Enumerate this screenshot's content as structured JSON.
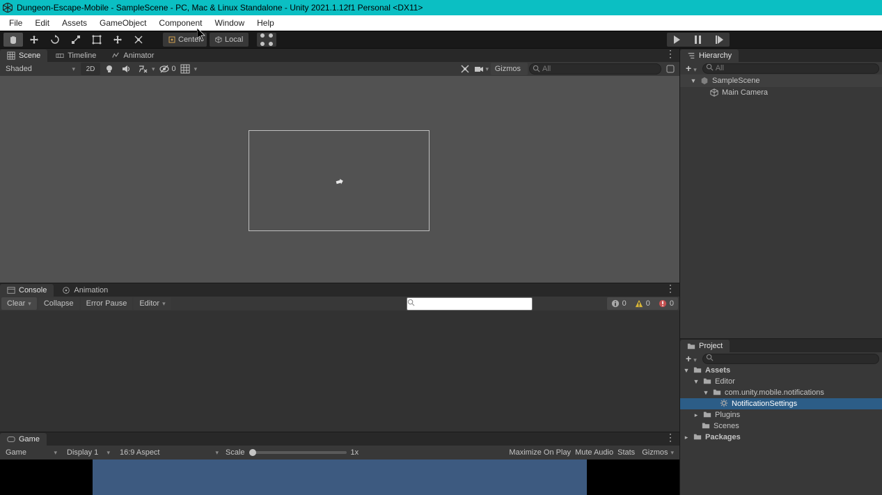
{
  "title": "Dungeon-Escape-Mobile - SampleScene - PC, Mac & Linux Standalone - Unity 2021.1.12f1 Personal <DX11>",
  "menu": [
    "File",
    "Edit",
    "Assets",
    "GameObject",
    "Component",
    "Window",
    "Help"
  ],
  "pivot": {
    "center": "Center",
    "local": "Local"
  },
  "tabs": {
    "scene": "Scene",
    "timeline": "Timeline",
    "animator": "Animator",
    "console": "Console",
    "animation": "Animation",
    "game": "Game",
    "hierarchy": "Hierarchy",
    "project": "Project"
  },
  "scene_toolbar": {
    "draw_mode": "Shaded",
    "mode2d": "2D",
    "zero": "0",
    "gizmos": "Gizmos",
    "search_placeholder": "All"
  },
  "console": {
    "clear": "Clear",
    "collapse": "Collapse",
    "error_pause": "Error Pause",
    "editor": "Editor",
    "counts": {
      "info": "0",
      "warn": "0",
      "error": "0"
    }
  },
  "game_toolbar": {
    "game": "Game",
    "display": "Display 1",
    "aspect": "16:9 Aspect",
    "scale_label": "Scale",
    "scale_value": "1x",
    "maximize": "Maximize On Play",
    "mute": "Mute Audio",
    "stats": "Stats",
    "gizmos": "Gizmos"
  },
  "hierarchy": {
    "search_placeholder": "All",
    "scene": "SampleScene",
    "items": [
      "Main Camera"
    ]
  },
  "project": {
    "tree": {
      "assets": "Assets",
      "editor": "Editor",
      "notif_folder": "com.unity.mobile.notifications",
      "notif_settings": "NotificationSettings",
      "plugins": "Plugins",
      "scenes": "Scenes",
      "packages": "Packages"
    }
  }
}
